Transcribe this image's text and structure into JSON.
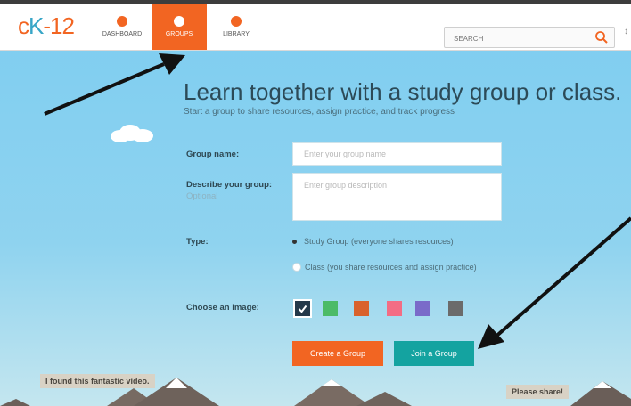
{
  "header": {
    "logo_c": "c",
    "logo_k": "K",
    "logo_num": "-12",
    "tabs": [
      {
        "label": "DASHBOARD",
        "icon": "dashboard-icon"
      },
      {
        "label": "GROUPS",
        "icon": "groups-icon",
        "active": true
      },
      {
        "label": "LIBRARY",
        "icon": "library-icon"
      }
    ],
    "search_placeholder": "SEARCH",
    "edge_glyph": "↕"
  },
  "main": {
    "heading": "Learn together with a study group or class.",
    "subheading": "Start a group to share resources, assign practice, and track progress",
    "form": {
      "group_name_label": "Group name:",
      "group_name_placeholder": "Enter your group name",
      "describe_label": "Describe your group:",
      "describe_optional": "Optional",
      "describe_placeholder": "Enter group description",
      "type_label": "Type:",
      "type_options": [
        {
          "label": "Study Group (everyone shares resources)",
          "selected": true
        },
        {
          "label": "Class (you share resources and assign practice)",
          "selected": false
        }
      ],
      "image_label": "Choose an image:",
      "image_swatches": [
        {
          "color": "#24394a",
          "selected": true
        },
        {
          "color": "#4cbb67",
          "selected": false
        },
        {
          "color": "#d9622c",
          "selected": false
        },
        {
          "color": "#f36d84",
          "selected": false
        },
        {
          "color": "#7a6bc9",
          "selected": false
        },
        {
          "color": "#6b6b6b",
          "selected": false
        }
      ],
      "create_button": "Create a Group",
      "join_button": "Join a Group"
    }
  },
  "annotations": {
    "left_note": "I found this fantastic video.",
    "right_note": "Please share!"
  },
  "colors": {
    "brand_orange": "#f26522",
    "brand_teal": "#14a3a0",
    "sky": "#8fd3ef"
  }
}
